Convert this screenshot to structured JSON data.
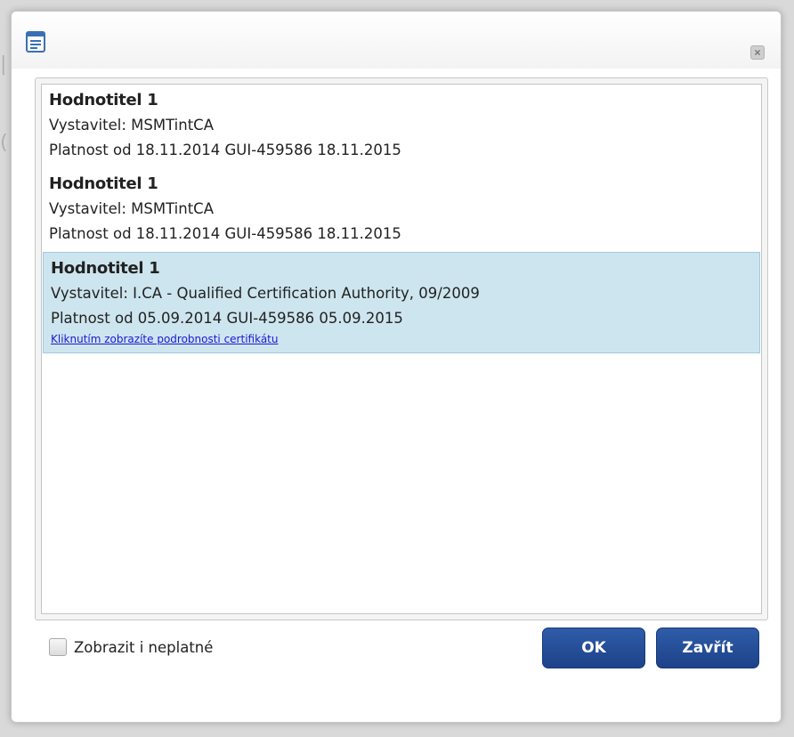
{
  "dialog": {
    "window_icon": "list-window-icon",
    "close_icon": "close-x-icon"
  },
  "certificates": [
    {
      "name": "Hodnotitel 1",
      "issuer": "Vystavitel: MSMTintCA",
      "validity": "Platnost od 18.11.2014 GUI-459586 18.11.2015",
      "selected": false
    },
    {
      "name": "Hodnotitel 1",
      "issuer": "Vystavitel: MSMTintCA",
      "validity": "Platnost od 18.11.2014 GUI-459586 18.11.2015",
      "selected": false
    },
    {
      "name": "Hodnotitel 1",
      "issuer": "Vystavitel: I.CA - Qualified Certification Authority, 09/2009",
      "validity": "Platnost od 05.09.2014 GUI-459586 05.09.2015",
      "detail_link": "Kliknutím zobrazíte podrobnosti certifikátu",
      "selected": true
    }
  ],
  "footer": {
    "show_invalid_label": "Zobrazit i neplatné",
    "show_invalid_checked": false,
    "ok_label": "OK",
    "close_label": "Zavřít"
  },
  "colors": {
    "selected_row": "#cde5ee",
    "button": "#1d4289",
    "link": "#1a1ad6"
  }
}
